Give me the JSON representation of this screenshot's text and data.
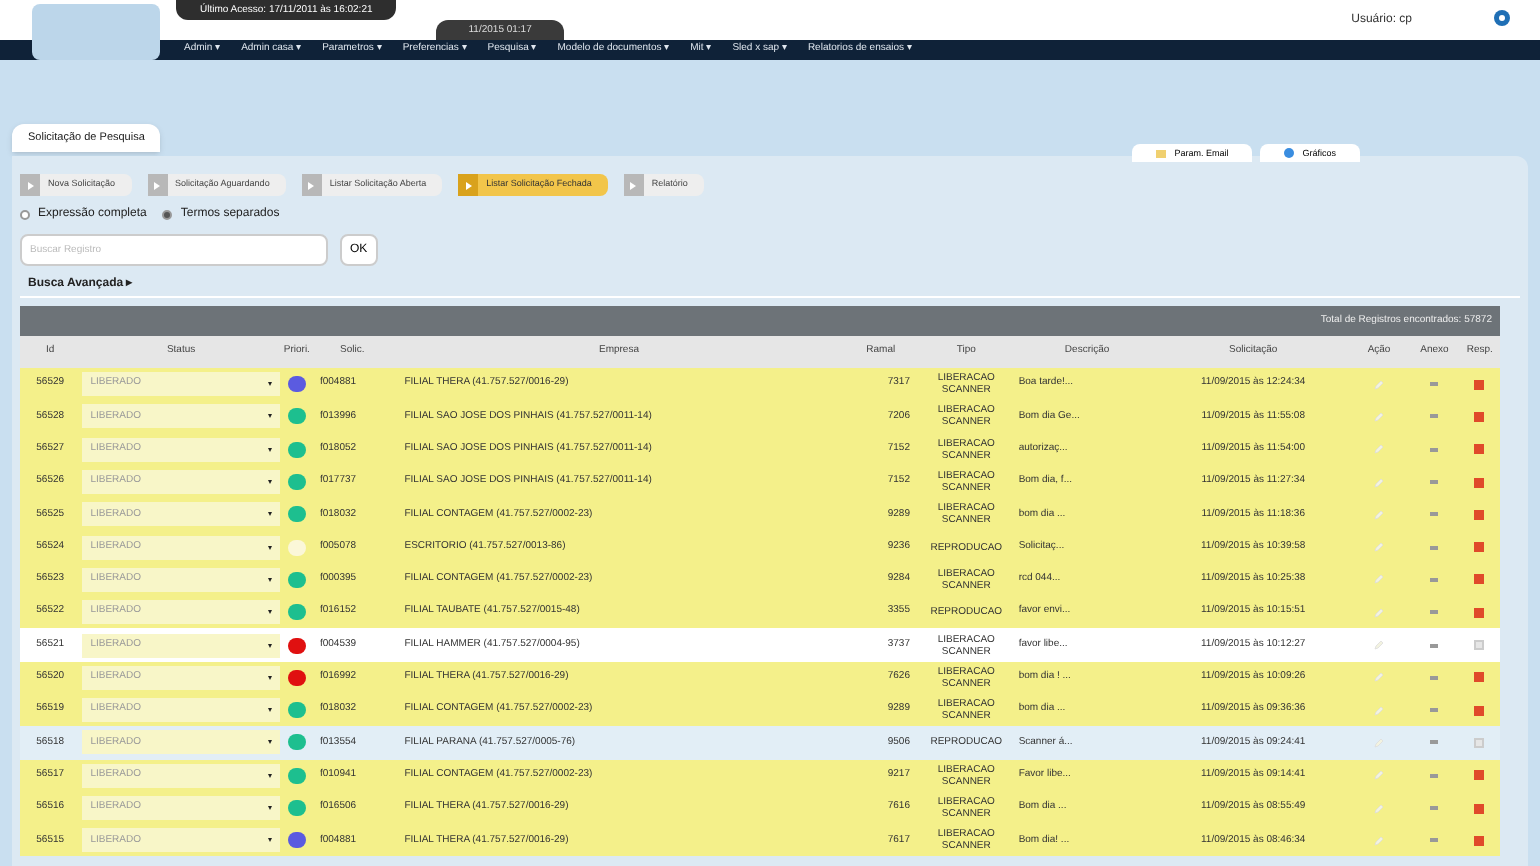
{
  "header": {
    "last_access": "Último Acesso: 17/11/2011 às 16:02:21",
    "clock": "11/2015 01:17",
    "user": "Usuário: cp"
  },
  "menu": [
    "Admin ▾",
    "Admin casa ▾",
    "Parametros ▾",
    "Preferencias ▾",
    "Pesquisa ▾",
    "Modelo de documentos ▾",
    "Mit ▾",
    "Sled x sap ▾",
    "Relatorios de ensaios ▾"
  ],
  "page_tab": "Solicitação de Pesquisa",
  "top_links": [
    "Param. Email",
    "Gráficos"
  ],
  "actions": [
    {
      "label": "Nova Solicitação",
      "selected": false
    },
    {
      "label": "Solicitação Aguardando",
      "selected": false
    },
    {
      "label": "Listar Solicitação Aberta",
      "selected": false
    },
    {
      "label": "Listar Solicitação Fechada",
      "selected": true
    },
    {
      "label": "Relatório",
      "selected": false
    }
  ],
  "search_modes": [
    {
      "label": "Expressão completa",
      "selected": false
    },
    {
      "label": "Termos separados",
      "selected": true
    }
  ],
  "search": {
    "placeholder": "Buscar Registro",
    "button": "OK"
  },
  "advanced": "Busca Avançada ▸",
  "total": "Total de Registros encontrados: 57872",
  "columns": [
    "Id",
    "Status",
    "Priori.",
    "Solic.",
    "Empresa",
    "Ramal",
    "Tipo",
    "Descrição",
    "Solicitação",
    "Ação",
    "Anexo",
    "Resp."
  ],
  "rows": [
    {
      "id": "56529",
      "status": "LIBERADO",
      "priority": {
        "color": "#5b5be0"
      },
      "solic": "f004881",
      "empresa": "FILIAL THERA (41.757.527/0016-29)",
      "ramal": "7317",
      "tipo": "LIBERACAO SCANNER",
      "descricao": "Boa tarde!...",
      "solicitacao": "11/09/2015 às 12:24:34",
      "color": "#f4f08a",
      "resp_active": true
    },
    {
      "id": "56528",
      "status": "LIBERADO",
      "priority": {
        "color": "#1dbf8f"
      },
      "solic": "f013996",
      "empresa": "FILIAL SAO JOSE DOS PINHAIS (41.757.527/0011-14)",
      "ramal": "7206",
      "tipo": "LIBERACAO SCANNER",
      "descricao": "Bom dia Ge...",
      "solicitacao": "11/09/2015 às 11:55:08",
      "color": "#f4f08a",
      "resp_active": true
    },
    {
      "id": "56527",
      "status": "LIBERADO",
      "priority": {
        "color": "#1dbf8f"
      },
      "solic": "f018052",
      "empresa": "FILIAL SAO JOSE DOS PINHAIS (41.757.527/0011-14)",
      "ramal": "7152",
      "tipo": "LIBERACAO SCANNER",
      "descricao": "autorizaç...",
      "solicitacao": "11/09/2015 às 11:54:00",
      "color": "#f4f08a",
      "resp_active": true
    },
    {
      "id": "56526",
      "status": "LIBERADO",
      "priority": {
        "color": "#1dbf8f"
      },
      "solic": "f017737",
      "empresa": "FILIAL SAO JOSE DOS PINHAIS (41.757.527/0011-14)",
      "ramal": "7152",
      "tipo": "LIBERACAO SCANNER",
      "descricao": "Bom dia, f...",
      "solicitacao": "11/09/2015 às 11:27:34",
      "color": "#f4f08a",
      "resp_active": true
    },
    {
      "id": "56525",
      "status": "LIBERADO",
      "priority": {
        "color": "#1dbf8f"
      },
      "solic": "f018032",
      "empresa": "FILIAL CONTAGEM (41.757.527/0002-23)",
      "ramal": "9289",
      "tipo": "LIBERACAO SCANNER",
      "descricao": "bom dia ...",
      "solicitacao": "11/09/2015 às 11:18:36",
      "color": "#f4f08a",
      "resp_active": true
    },
    {
      "id": "56524",
      "status": "LIBERADO",
      "priority": {
        "color": "#fbf7d8"
      },
      "solic": "f005078",
      "empresa": "ESCRITORIO (41.757.527/0013-86)",
      "ramal": "9236",
      "tipo": "REPRODUCAO",
      "descricao": "Solicitaç...",
      "solicitacao": "11/09/2015 às 10:39:58",
      "color": "#f4f08a",
      "resp_active": true
    },
    {
      "id": "56523",
      "status": "LIBERADO",
      "priority": {
        "color": "#1dbf8f"
      },
      "solic": "f000395",
      "empresa": "FILIAL CONTAGEM (41.757.527/0002-23)",
      "ramal": "9284",
      "tipo": "LIBERACAO SCANNER",
      "descricao": "rcd 044...",
      "solicitacao": "11/09/2015 às 10:25:38",
      "color": "#f4f08a",
      "resp_active": true
    },
    {
      "id": "56522",
      "status": "LIBERADO",
      "priority": {
        "color": "#1dbf8f"
      },
      "solic": "f016152",
      "empresa": "FILIAL TAUBATE (41.757.527/0015-48)",
      "ramal": "3355",
      "tipo": "REPRODUCAO",
      "descricao": "favor envi...",
      "solicitacao": "11/09/2015 às 10:15:51",
      "color": "#f4f08a",
      "resp_active": true
    },
    {
      "id": "56521",
      "status": "LIBERADO",
      "priority": {
        "color": "#e01010"
      },
      "solic": "f004539",
      "empresa": "FILIAL HAMMER (41.757.527/0004-95)",
      "ramal": "3737",
      "tipo": "LIBERACAO SCANNER",
      "descricao": "favor libe...",
      "solicitacao": "11/09/2015 às 10:12:27",
      "color": "#ffffff",
      "resp_active": false
    },
    {
      "id": "56520",
      "status": "LIBERADO",
      "priority": {
        "color": "#e01010"
      },
      "solic": "f016992",
      "empresa": "FILIAL THERA (41.757.527/0016-29)",
      "ramal": "7626",
      "tipo": "LIBERACAO SCANNER",
      "descricao": "bom dia ! ...",
      "solicitacao": "11/09/2015 às 10:09:26",
      "color": "#f4f08a",
      "resp_active": true
    },
    {
      "id": "56519",
      "status": "LIBERADO",
      "priority": {
        "color": "#1dbf8f"
      },
      "solic": "f018032",
      "empresa": "FILIAL CONTAGEM (41.757.527/0002-23)",
      "ramal": "9289",
      "tipo": "LIBERACAO SCANNER",
      "descricao": "bom dia ...",
      "solicitacao": "11/09/2015 às 09:36:36",
      "color": "#f4f08a",
      "resp_active": true
    },
    {
      "id": "56518",
      "status": "LIBERADO",
      "priority": {
        "color": "#1dbf8f"
      },
      "solic": "f013554",
      "empresa": "FILIAL PARANA (41.757.527/0005-76)",
      "ramal": "9506",
      "tipo": "REPRODUCAO",
      "descricao": "Scanner á...",
      "solicitacao": "11/09/2015 às 09:24:41",
      "color": "#e2eef6",
      "resp_active": false
    },
    {
      "id": "56517",
      "status": "LIBERADO",
      "priority": {
        "color": "#1dbf8f"
      },
      "solic": "f010941",
      "empresa": "FILIAL CONTAGEM (41.757.527/0002-23)",
      "ramal": "9217",
      "tipo": "LIBERACAO SCANNER",
      "descricao": "Favor libe...",
      "solicitacao": "11/09/2015 às 09:14:41",
      "color": "#f4f08a",
      "resp_active": true
    },
    {
      "id": "56516",
      "status": "LIBERADO",
      "priority": {
        "color": "#1dbf8f"
      },
      "solic": "f016506",
      "empresa": "FILIAL THERA (41.757.527/0016-29)",
      "ramal": "7616",
      "tipo": "LIBERACAO SCANNER",
      "descricao": "Bom dia ...",
      "solicitacao": "11/09/2015 às 08:55:49",
      "color": "#f4f08a",
      "resp_active": true
    },
    {
      "id": "56515",
      "status": "LIBERADO",
      "priority": {
        "color": "#5b5be0"
      },
      "solic": "f004881",
      "empresa": "FILIAL THERA (41.757.527/0016-29)",
      "ramal": "7617",
      "tipo": "LIBERACAO SCANNER",
      "descricao": "Bom dia! ...",
      "solicitacao": "11/09/2015 às 08:46:34",
      "color": "#f4f08a",
      "resp_active": true
    }
  ]
}
